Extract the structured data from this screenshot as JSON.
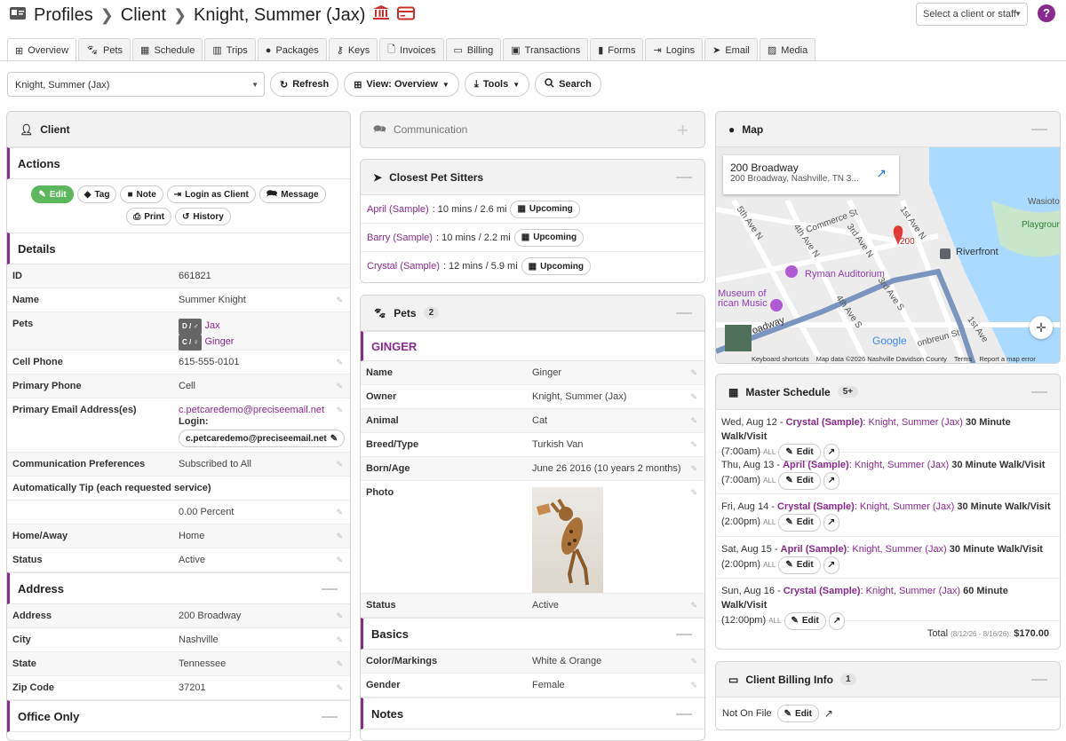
{
  "header": {
    "profiles": "Profiles",
    "client": "Client",
    "name": "Knight, Summer (Jax)",
    "select_placeholder": "Select a client or staff",
    "help": "?"
  },
  "tabs": [
    "Overview",
    "Pets",
    "Schedule",
    "Trips",
    "Packages",
    "Keys",
    "Invoices",
    "Billing",
    "Transactions",
    "Forms",
    "Logins",
    "Email",
    "Media"
  ],
  "toolbar": {
    "client_value": "Knight, Summer (Jax)",
    "refresh": "Refresh",
    "view": "View: Overview",
    "tools": "Tools",
    "search": "Search"
  },
  "client_panel": {
    "title": "Client",
    "actions_title": "Actions",
    "actions": {
      "edit": "Edit",
      "tag": "Tag",
      "note": "Note",
      "login_as": "Login as Client",
      "message": "Message",
      "print": "Print",
      "history": "History"
    },
    "details_title": "Details",
    "details": {
      "id_k": "ID",
      "id_v": "661821",
      "name_k": "Name",
      "name_v": "Summer Knight",
      "pets_k": "Pets",
      "pet1_tag": "D / ♂",
      "pet1": "Jax",
      "pet2_tag": "C / ♀",
      "pet2": "Ginger",
      "cell_k": "Cell Phone",
      "cell_v": "615-555-0101",
      "primary_k": "Primary Phone",
      "primary_v": "Cell",
      "email_k": "Primary Email Address(es)",
      "email_v": "c.petcaredemo@preciseemail.net",
      "login_label": "Login:",
      "login_v": "c.petcaredemo@preciseemail.net",
      "comm_k": "Communication Preferences",
      "comm_v": "Subscribed to All",
      "tip_k": "Automatically Tip (each requested service)",
      "tip_v": "0.00 Percent",
      "home_k": "Home/Away",
      "home_v": "Home",
      "status_k": "Status",
      "status_v": "Active"
    },
    "address_title": "Address",
    "address": {
      "addr_k": "Address",
      "addr_v": "200 Broadway",
      "city_k": "City",
      "city_v": "Nashville",
      "state_k": "State",
      "state_v": "Tennessee",
      "zip_k": "Zip Code",
      "zip_v": "37201"
    },
    "office_title": "Office Only"
  },
  "communication": {
    "title": "Communication"
  },
  "sitters": {
    "title": "Closest Pet Sitters",
    "items": [
      {
        "name": "April (Sample)",
        "dist": ": 10 mins / 2.6 mi",
        "status": "Upcoming"
      },
      {
        "name": "Barry (Sample)",
        "dist": ": 10 mins / 2.2 mi",
        "status": "Upcoming"
      },
      {
        "name": "Crystal (Sample)",
        "dist": ": 12 mins / 5.9 mi",
        "status": "Upcoming"
      }
    ]
  },
  "pets_panel": {
    "title": "Pets",
    "count": "2",
    "pet_name": "GINGER",
    "name_k": "Name",
    "name_v": "Ginger",
    "owner_k": "Owner",
    "owner_v": "Knight, Summer (Jax)",
    "animal_k": "Animal",
    "animal_v": "Cat",
    "breed_k": "Breed/Type",
    "breed_v": "Turkish Van",
    "born_k": "Born/Age",
    "born_v": "June 26 2016 (10 years 2 months)",
    "photo_k": "Photo",
    "status_k": "Status",
    "status_v": "Active",
    "basics_title": "Basics",
    "color_k": "Color/Markings",
    "color_v": "White & Orange",
    "gender_k": "Gender",
    "gender_v": "Female",
    "notes_title": "Notes"
  },
  "map": {
    "title": "Map",
    "place": "200 Broadway",
    "address": "200 Broadway, Nashville, TN 3...",
    "labels": {
      "commerce": "Commerce St",
      "fifth": "5th Ave N",
      "fourth": "4th Ave N",
      "third": "3rd Ave N",
      "first": "1st Ave N",
      "ryman": "Ryman Auditorium",
      "riverfront": "Riverfront",
      "museum": "Museum of\nrican Music",
      "broadway": "oadway",
      "fourths": "4th Ave S",
      "thirds": "3rd Ave S",
      "broon": "onbreun St",
      "firsts": "1st Ave",
      "waterfront": "Wasioto",
      "playground": "Playgroun",
      "num": "200",
      "google": "Google"
    },
    "footer": {
      "shortcuts": "Keyboard shortcuts",
      "mapdata": "Map data ©2026 Nashville Davidson County",
      "terms": "Terms",
      "report": "Report a map error"
    }
  },
  "schedule": {
    "title": "Master Schedule",
    "count": "5+",
    "items": [
      {
        "date": "Wed, Aug 12 - ",
        "sitter": "Crystal (Sample)",
        "client": "Knight, Summer (Jax)",
        "service": "30 Minute Walk/Visit",
        "time": "(7:00am)"
      },
      {
        "date": "Thu, Aug 13 - ",
        "sitter": "April (Sample)",
        "client": "Knight, Summer (Jax)",
        "service": "30 Minute Walk/Visit",
        "time": "(7:00am)"
      },
      {
        "date": "Fri, Aug 14 - ",
        "sitter": "Crystal (Sample)",
        "client": "Knight, Summer (Jax)",
        "service": "30 Minute Walk/Visit",
        "time": "(2:00pm)"
      },
      {
        "date": "Sat, Aug 15 - ",
        "sitter": "April (Sample)",
        "client": "Knight, Summer (Jax)",
        "service": "30 Minute Walk/Visit",
        "time": "(2:00pm)"
      },
      {
        "date": "Sun, Aug 16 - ",
        "sitter": "Crystal (Sample)",
        "client": "Knight, Summer (Jax)",
        "service": "60 Minute Walk/Visit",
        "time": "(12:00pm)"
      }
    ],
    "all": "ALL",
    "edit": "Edit",
    "total_label": "Total",
    "total_range": "(8/12/26 - 8/16/26):",
    "total_value": "$170.00"
  },
  "billing": {
    "title": "Client Billing Info",
    "count": "1",
    "status": "Not On File",
    "edit": "Edit"
  },
  "colors": {
    "accent": "#8a2a8f",
    "green": "#5cb85c",
    "map_water": "#aadaff"
  }
}
